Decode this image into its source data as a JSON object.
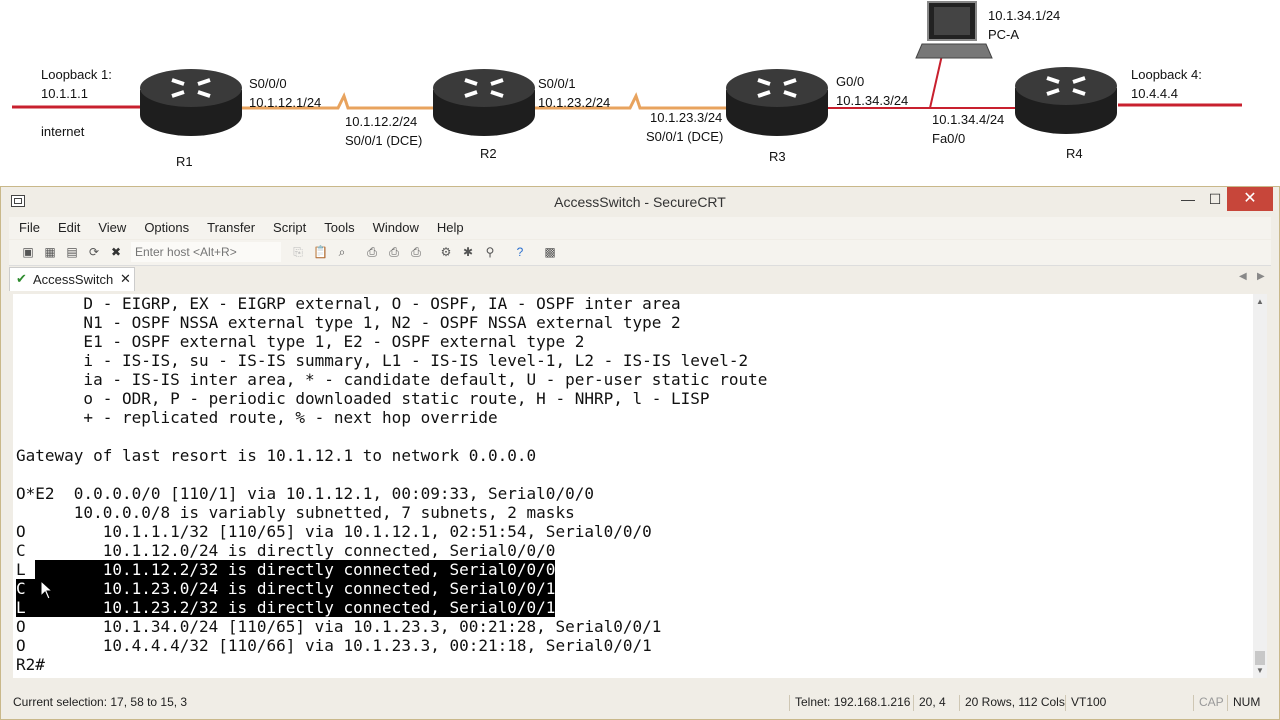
{
  "topology": {
    "routers": [
      {
        "name": "R1",
        "loopback_label": "Loopback 1:",
        "loopback_ip": "10.1.1.1",
        "extra": "internet"
      },
      {
        "name": "R2"
      },
      {
        "name": "R3"
      },
      {
        "name": "R4",
        "loopback_label": "Loopback 4:",
        "loopback_ip": "10.4.4.4"
      }
    ],
    "pc": {
      "name": "PC-A",
      "ip": "10.1.34.1/24"
    },
    "links": {
      "r1_iface": "S0/0/0",
      "r1_ip": "10.1.12.1/24",
      "r2_left_ip": "10.1.12.2/24",
      "r2_left_iface": "S0/0/1 (DCE)",
      "r2_right_iface": "S0/0/1",
      "r2_right_ip": "10.1.23.2/24",
      "r3_left_ip": "10.1.23.3/24",
      "r3_left_iface": "S0/0/1 (DCE)",
      "r3_right_iface": "G0/0",
      "r3_right_ip": "10.1.34.3/24",
      "r4_ip": "10.1.34.4/24",
      "r4_iface": "Fa0/0"
    },
    "colors": {
      "serial": "#e8a35e",
      "ethernet": "#c8202e"
    }
  },
  "window": {
    "title": "AccessSwitch - SecureCRT",
    "min_glyph": "—",
    "max_glyph": "☐",
    "close_glyph": "✕"
  },
  "menu": [
    "File",
    "Edit",
    "View",
    "Options",
    "Transfer",
    "Script",
    "Tools",
    "Window",
    "Help"
  ],
  "toolbar": {
    "host_placeholder": "Enter host <Alt+R>"
  },
  "tab": {
    "label": "AccessSwitch",
    "check": "✔",
    "close": "✕"
  },
  "terminal": {
    "lines": [
      "       D - EIGRP, EX - EIGRP external, O - OSPF, IA - OSPF inter area",
      "       N1 - OSPF NSSA external type 1, N2 - OSPF NSSA external type 2",
      "       E1 - OSPF external type 1, E2 - OSPF external type 2",
      "       i - IS-IS, su - IS-IS summary, L1 - IS-IS level-1, L2 - IS-IS level-2",
      "       ia - IS-IS inter area, * - candidate default, U - per-user static route",
      "       o - ODR, P - periodic downloaded static route, H - NHRP, l - LISP",
      "       + - replicated route, % - next hop override",
      "",
      "Gateway of last resort is 10.1.12.1 to network 0.0.0.0",
      "",
      "O*E2  0.0.0.0/0 [110/1] via 10.1.12.1, 00:09:33, Serial0/0/0",
      "      10.0.0.0/8 is variably subnetted, 7 subnets, 2 masks",
      "O        10.1.1.1/32 [110/65] via 10.1.12.1, 02:51:54, Serial0/0/0",
      "C        10.1.12.0/24 is directly connected, Serial0/0/0"
    ],
    "selected": [
      {
        "prefix": "L ",
        "rest": "       10.1.12.2/32 is directly connected, Serial0/0/0"
      },
      {
        "prefix": "C ",
        "rest": "       10.1.23.0/24 is directly connected, Serial0/0/1"
      },
      {
        "prefix": "L ",
        "rest": "       10.1.23.2/32 is directly connected, Serial0/0/1"
      }
    ],
    "after": [
      "O        10.1.34.0/24 [110/65] via 10.1.23.3, 00:21:28, Serial0/0/1",
      "O        10.4.4.4/32 [110/66] via 10.1.23.3, 00:21:18, Serial0/0/1",
      "R2#"
    ]
  },
  "status": {
    "selection": "Current selection: 17, 58 to 15, 3",
    "connection": "Telnet: 192.168.1.216",
    "cursor_pos": "20,  4",
    "size": "20 Rows, 112 Cols",
    "emulation": "VT100",
    "cap": "CAP",
    "num": "NUM"
  }
}
